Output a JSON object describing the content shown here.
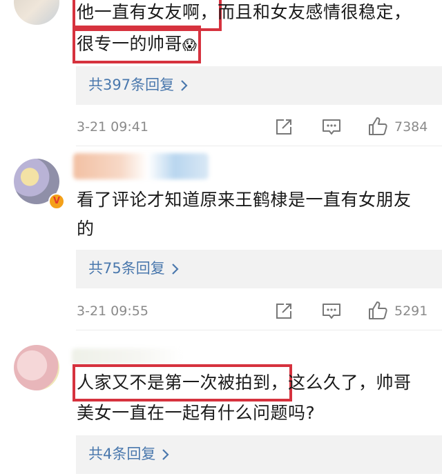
{
  "comments": [
    {
      "text_part1": "他一直有女友啊，",
      "text_part2": "而且和女友感情很稳定，",
      "text_line2": "很专一的帅哥",
      "emoji": "😱",
      "replies": "共397条回复",
      "time": "3-21 09:41",
      "likes": "7384"
    },
    {
      "text_line1": "看了评论才知道原来王鹤棣是一直有女朋友",
      "text_line2": "的",
      "replies": "共75条回复",
      "time": "3-21 09:55",
      "likes": "5291",
      "badge": "V"
    },
    {
      "text_hl": "人家又不是第一次被拍到，",
      "text_part2": "这么久了，帅哥",
      "text_line2": "美女一直在一起有什么问题吗?",
      "replies": "共4条回复"
    }
  ],
  "icons": {
    "chevron": "chevron-right-icon",
    "share": "share-icon",
    "comment": "comment-icon",
    "like": "like-icon"
  },
  "colors": {
    "highlight": "#d6323e",
    "link": "#4a78ad",
    "meta": "#8a8a8a",
    "reply_bg": "#f2f2f2"
  }
}
